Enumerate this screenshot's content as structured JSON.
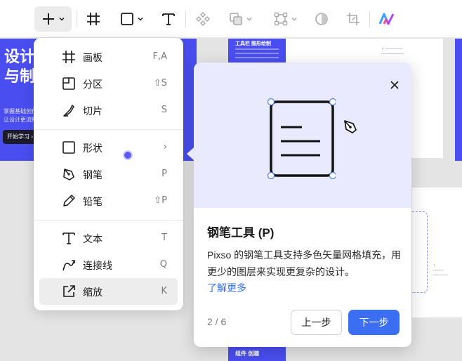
{
  "toolbar": {
    "tools": [
      {
        "name": "insert-tool",
        "icon": "plus-icon",
        "has_dropdown": true,
        "active": true
      },
      {
        "name": "frame-tool",
        "icon": "frame-hash-icon",
        "has_dropdown": false
      },
      {
        "name": "shape-tool",
        "icon": "square-icon",
        "has_dropdown": true
      },
      {
        "name": "text-tool",
        "icon": "text-t-icon",
        "has_dropdown": false
      },
      {
        "name": "component-tool",
        "icon": "component-diamond-icon",
        "has_dropdown": false
      },
      {
        "name": "boolean-tool",
        "icon": "boolean-union-icon",
        "has_dropdown": true
      },
      {
        "name": "vector-edit-tool",
        "icon": "vector-nodes-icon",
        "has_dropdown": true
      },
      {
        "name": "mask-tool",
        "icon": "mask-circle-icon",
        "has_dropdown": false
      },
      {
        "name": "crop-tool",
        "icon": "crop-icon",
        "has_dropdown": false
      },
      {
        "name": "ai-tool",
        "icon": "ai-logo-icon",
        "has_dropdown": false
      }
    ]
  },
  "canvas": {
    "left_frame": {
      "title_line1": "设计",
      "title_line2": "与制",
      "subtitle_line1": "掌握基础创作",
      "subtitle_line2": "让设计更流畅",
      "button": "开始学习 ›"
    },
    "top_frame": {
      "heading": "工具栏 图形绘制"
    },
    "bottom_frame": {
      "heading": "组件 创建"
    }
  },
  "menu": {
    "groups": [
      [
        {
          "icon": "frame-hash-icon",
          "label": "画板",
          "shortcut": "F,A"
        },
        {
          "icon": "section-icon",
          "label": "分区",
          "shortcut": "⇧S"
        },
        {
          "icon": "slice-knife-icon",
          "label": "切片",
          "shortcut": "S"
        }
      ],
      [
        {
          "icon": "square-icon",
          "label": "形状",
          "shortcut": "›"
        },
        {
          "icon": "pen-nib-icon",
          "label": "钢笔",
          "shortcut": "P"
        },
        {
          "icon": "pencil-icon",
          "label": "铅笔",
          "shortcut": "⇧P"
        }
      ],
      [
        {
          "icon": "text-t-icon",
          "label": "文本",
          "shortcut": "T"
        },
        {
          "icon": "connector-arrow-icon",
          "label": "连接线",
          "shortcut": "Q"
        },
        {
          "icon": "external-link-icon",
          "label": "缩放",
          "shortcut": "K",
          "highlighted": true
        }
      ]
    ]
  },
  "card": {
    "title": "钢笔工具 (P)",
    "body": "Pixso 的钢笔工具支持多色矢量网格填充，用更少的图层来实现更复杂的设计。",
    "link": "了解更多",
    "step": "2 / 6",
    "prev": "上一步",
    "next": "下一步",
    "illustration_icons": [
      "document-icon",
      "pen-cursor-icon"
    ],
    "accent": "#3b6ef2",
    "illustration_bg": "#e9eafd"
  }
}
